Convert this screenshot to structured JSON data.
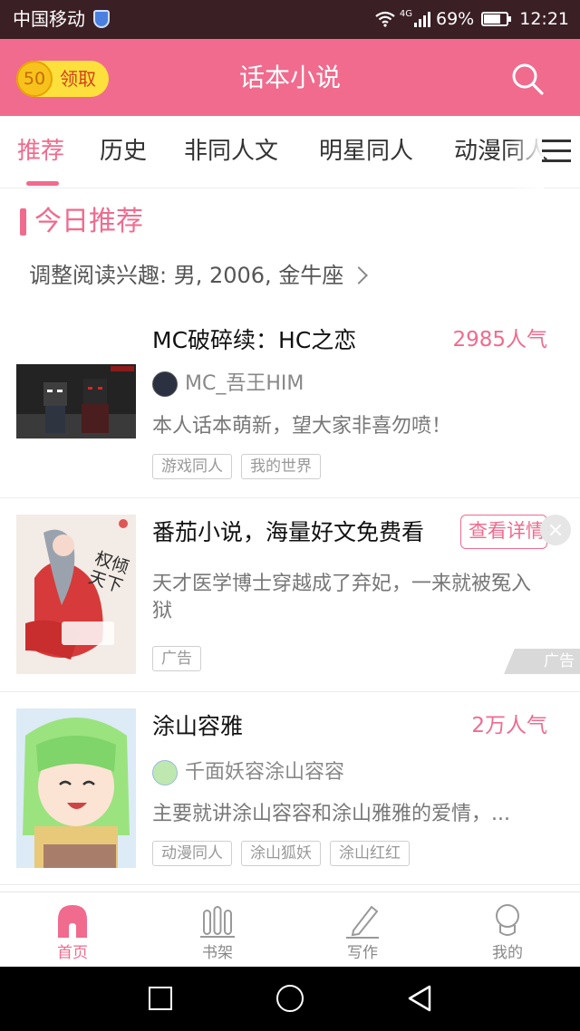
{
  "status_bar": {
    "carrier": "中国移动",
    "network": "4G",
    "battery": "69%",
    "battery_level": 0.69,
    "time": "12:21"
  },
  "header": {
    "coin_value": "50",
    "coin_label": "领取",
    "title": "话本小说",
    "search_icon": "search-icon",
    "colors": {
      "primary": "#f06b8e",
      "coin": "#fde03b"
    }
  },
  "tabs": [
    {
      "label": "推荐",
      "active": true
    },
    {
      "label": "历史"
    },
    {
      "label": "非同人文"
    },
    {
      "label": "明星同人"
    },
    {
      "label": "动漫同人"
    }
  ],
  "tabs_menu_icon": "menu-icon",
  "section": {
    "title": "今日推荐",
    "interest": "调整阅读兴趣: 男, 2006, 金牛座"
  },
  "books": [
    {
      "title": "MC破碎续：HC之恋",
      "popularity": "2985人气",
      "author": "MC_吾王HIM",
      "description": "本人话本萌新，望大家非喜勿喷！",
      "tags": [
        "游戏同人",
        "我的世界"
      ]
    },
    {
      "title": "番茄小说，海量好文免费看",
      "button": "查看详情",
      "description": "天才医学博士穿越成了弃妃，一来就被冤入狱",
      "tags": [
        "广告"
      ],
      "cover_text": "权倾天下",
      "corner_label": "广告"
    },
    {
      "title": "涂山容雅",
      "popularity": "2万人气",
      "author": "千面妖容涂山容容",
      "description": "主要就讲涂山容容和涂山雅雅的爱情，...",
      "tags": [
        "动漫同人",
        "涂山狐妖",
        "涂山红红"
      ]
    }
  ],
  "bottom_nav": [
    {
      "label": "首页",
      "icon": "home-icon",
      "active": true
    },
    {
      "label": "书架",
      "icon": "bookshelf-icon"
    },
    {
      "label": "写作",
      "icon": "pencil-icon"
    },
    {
      "label": "我的",
      "icon": "profile-icon"
    }
  ]
}
